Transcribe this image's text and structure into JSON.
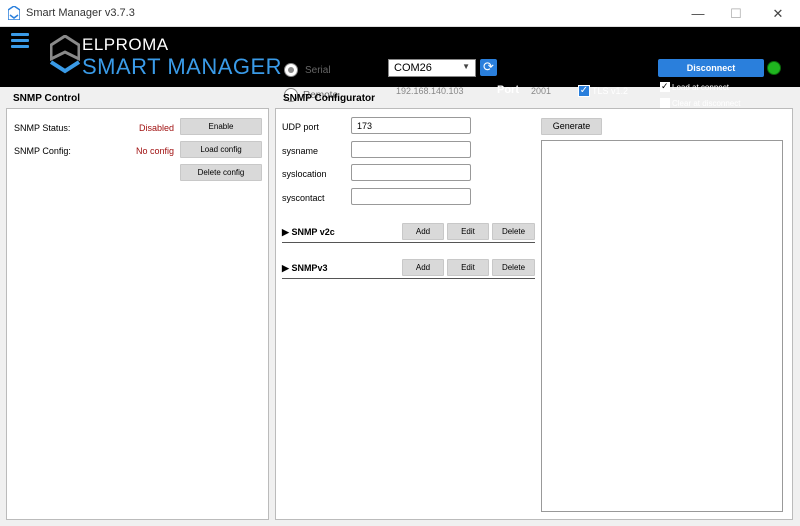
{
  "window": {
    "title": "Smart Manager v3.7.3",
    "minimize": "—",
    "maximize": "☐",
    "close": "✕"
  },
  "header": {
    "brand_top": "ELPROMA",
    "brand_bottom": "SMART MANAGER",
    "connection_modes": [
      {
        "label": "Serial",
        "selected": true
      },
      {
        "label": "Remote",
        "selected": false
      }
    ],
    "com_port": "COM26",
    "ip_address": "192.168.140.103",
    "port_label": "Port",
    "port_value": "2001",
    "tls": {
      "label": "TLS v1.2",
      "checked": true
    },
    "disconnect_label": "Disconnect",
    "status_color": "#1fb51f",
    "load_at_connect": {
      "label": "Load at connect",
      "checked": true
    },
    "clear_at_disconnect": {
      "label": "Clear at disconnect",
      "checked": false
    },
    "accent_color": "#2a7fdc"
  },
  "snmp_control": {
    "title": "SNMP Control",
    "status_label": "SNMP Status:",
    "status_value": "Disabled",
    "config_label": "SNMP Config:",
    "config_value": "No config",
    "enable_button": "Enable",
    "load_config_button": "Load config",
    "delete_config_button": "Delete config"
  },
  "snmp_configurator": {
    "title": "SNMP Configurator",
    "fields": [
      {
        "label": "UDP port",
        "value": "173"
      },
      {
        "label": "sysname",
        "value": ""
      },
      {
        "label": "syslocation",
        "value": ""
      },
      {
        "label": "syscontact",
        "value": ""
      }
    ],
    "generate_button": "Generate",
    "groups": [
      {
        "title": "SNMP v2c",
        "add": "Add",
        "edit": "Edit",
        "delete": "Delete"
      },
      {
        "title": "SNMPv3",
        "add": "Add",
        "edit": "Edit",
        "delete": "Delete"
      }
    ]
  }
}
